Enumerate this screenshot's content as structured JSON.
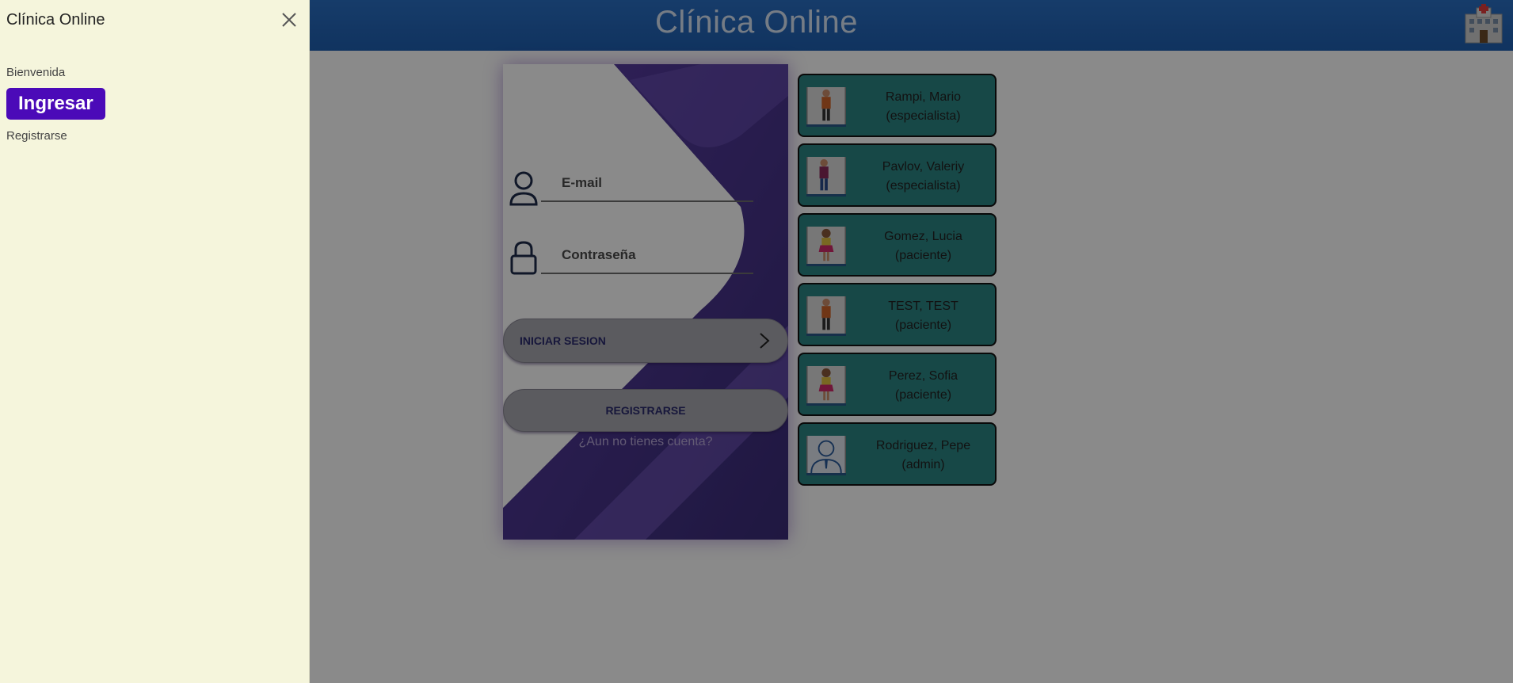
{
  "header": {
    "title": "Clínica Online",
    "logo_icon": "hospital-icon"
  },
  "sidebar": {
    "title": "Clínica Online",
    "close_icon": "close-icon",
    "welcome": "Bienvenida",
    "login_label": "Ingresar",
    "register_label": "Registrarse"
  },
  "login_form": {
    "email_placeholder": "E-mail",
    "password_placeholder": "Contraseña",
    "login_button": "INICIAR SESION",
    "register_button": "REGISTRARSE",
    "no_account": "¿Aun no tienes cuenta?"
  },
  "quick_users": [
    {
      "name": "Rampi, Mario",
      "role": "(especialista)"
    },
    {
      "name": "Pavlov, Valeriy",
      "role": "(especialista)"
    },
    {
      "name": "Gomez, Lucia",
      "role": "(paciente)"
    },
    {
      "name": "TEST, TEST",
      "role": "(paciente)"
    },
    {
      "name": "Perez, Sofia",
      "role": "(paciente)"
    },
    {
      "name": "Rodriguez, Pepe",
      "role": "(admin)"
    }
  ],
  "colors": {
    "header": "#1f5fb0",
    "sidebar_bg": "#f5f5dc",
    "login_button": "#4b0ab8",
    "user_card": "#2c8583",
    "card_purple": "#3b2a70"
  }
}
